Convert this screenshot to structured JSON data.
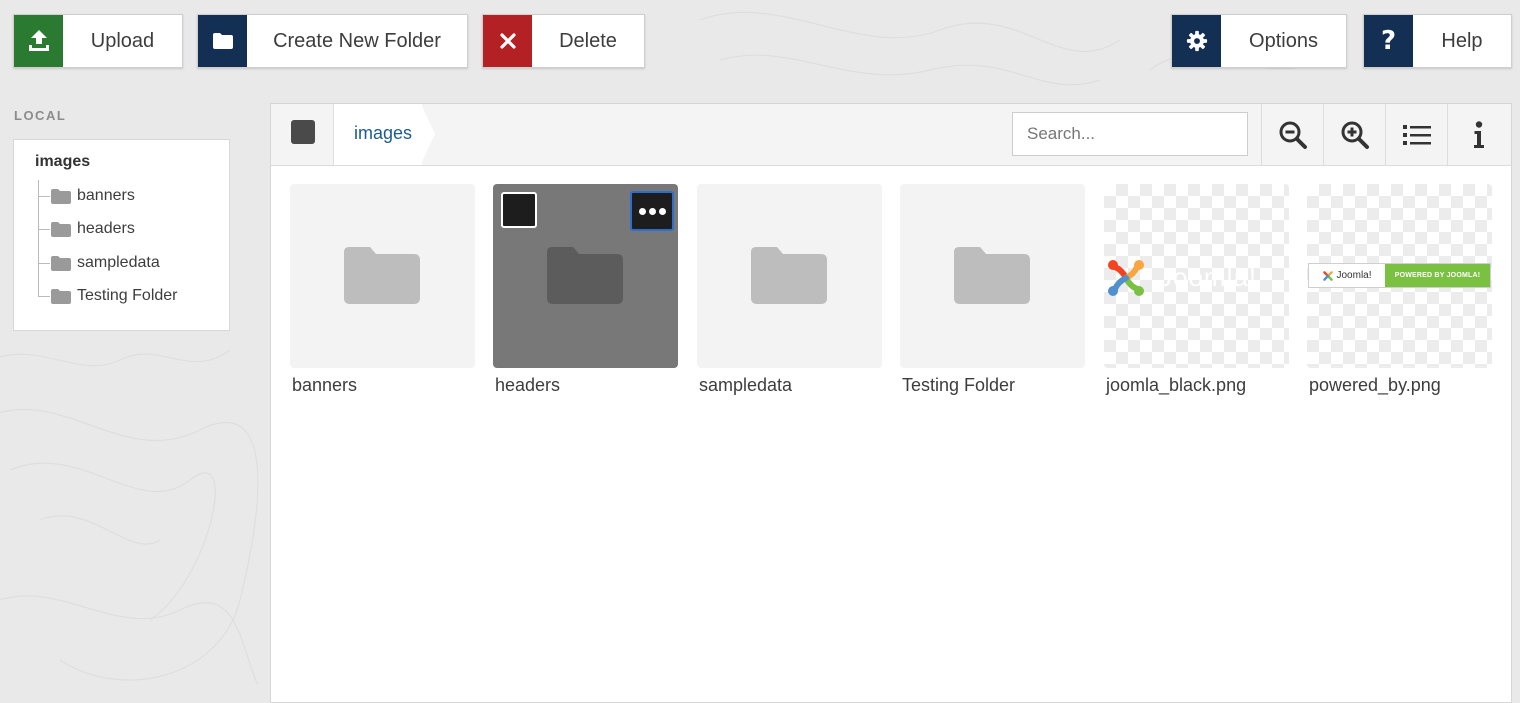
{
  "toolbar": {
    "upload_label": "Upload",
    "new_folder_label": "Create New Folder",
    "delete_label": "Delete",
    "options_label": "Options",
    "help_label": "Help"
  },
  "sidebar": {
    "section_label": "LOCAL",
    "root": "images",
    "items": [
      {
        "label": "banners",
        "icon": "folder-icon"
      },
      {
        "label": "headers",
        "icon": "folder-icon"
      },
      {
        "label": "sampledata",
        "icon": "folder-icon"
      },
      {
        "label": "Testing Folder",
        "icon": "folder-icon"
      }
    ]
  },
  "browser": {
    "breadcrumb": "images",
    "search": {
      "placeholder": "Search...",
      "value": ""
    },
    "items": [
      {
        "name": "banners",
        "type": "folder",
        "selected": false
      },
      {
        "name": "headers",
        "type": "folder",
        "selected": true
      },
      {
        "name": "sampledata",
        "type": "folder",
        "selected": false
      },
      {
        "name": "Testing Folder",
        "type": "folder",
        "selected": false
      },
      {
        "name": "joomla_black.png",
        "type": "image",
        "selected": false
      },
      {
        "name": "powered_by.png",
        "type": "image",
        "selected": false,
        "banner_text": "POWERED BY JOOMLA!",
        "brand_text": "Joomla!"
      }
    ]
  },
  "colors": {
    "upload": "#2a7a32",
    "navy": "#132f54",
    "delete": "#b42124",
    "link": "#1f5b92",
    "joomla_green": "#7ac142"
  }
}
